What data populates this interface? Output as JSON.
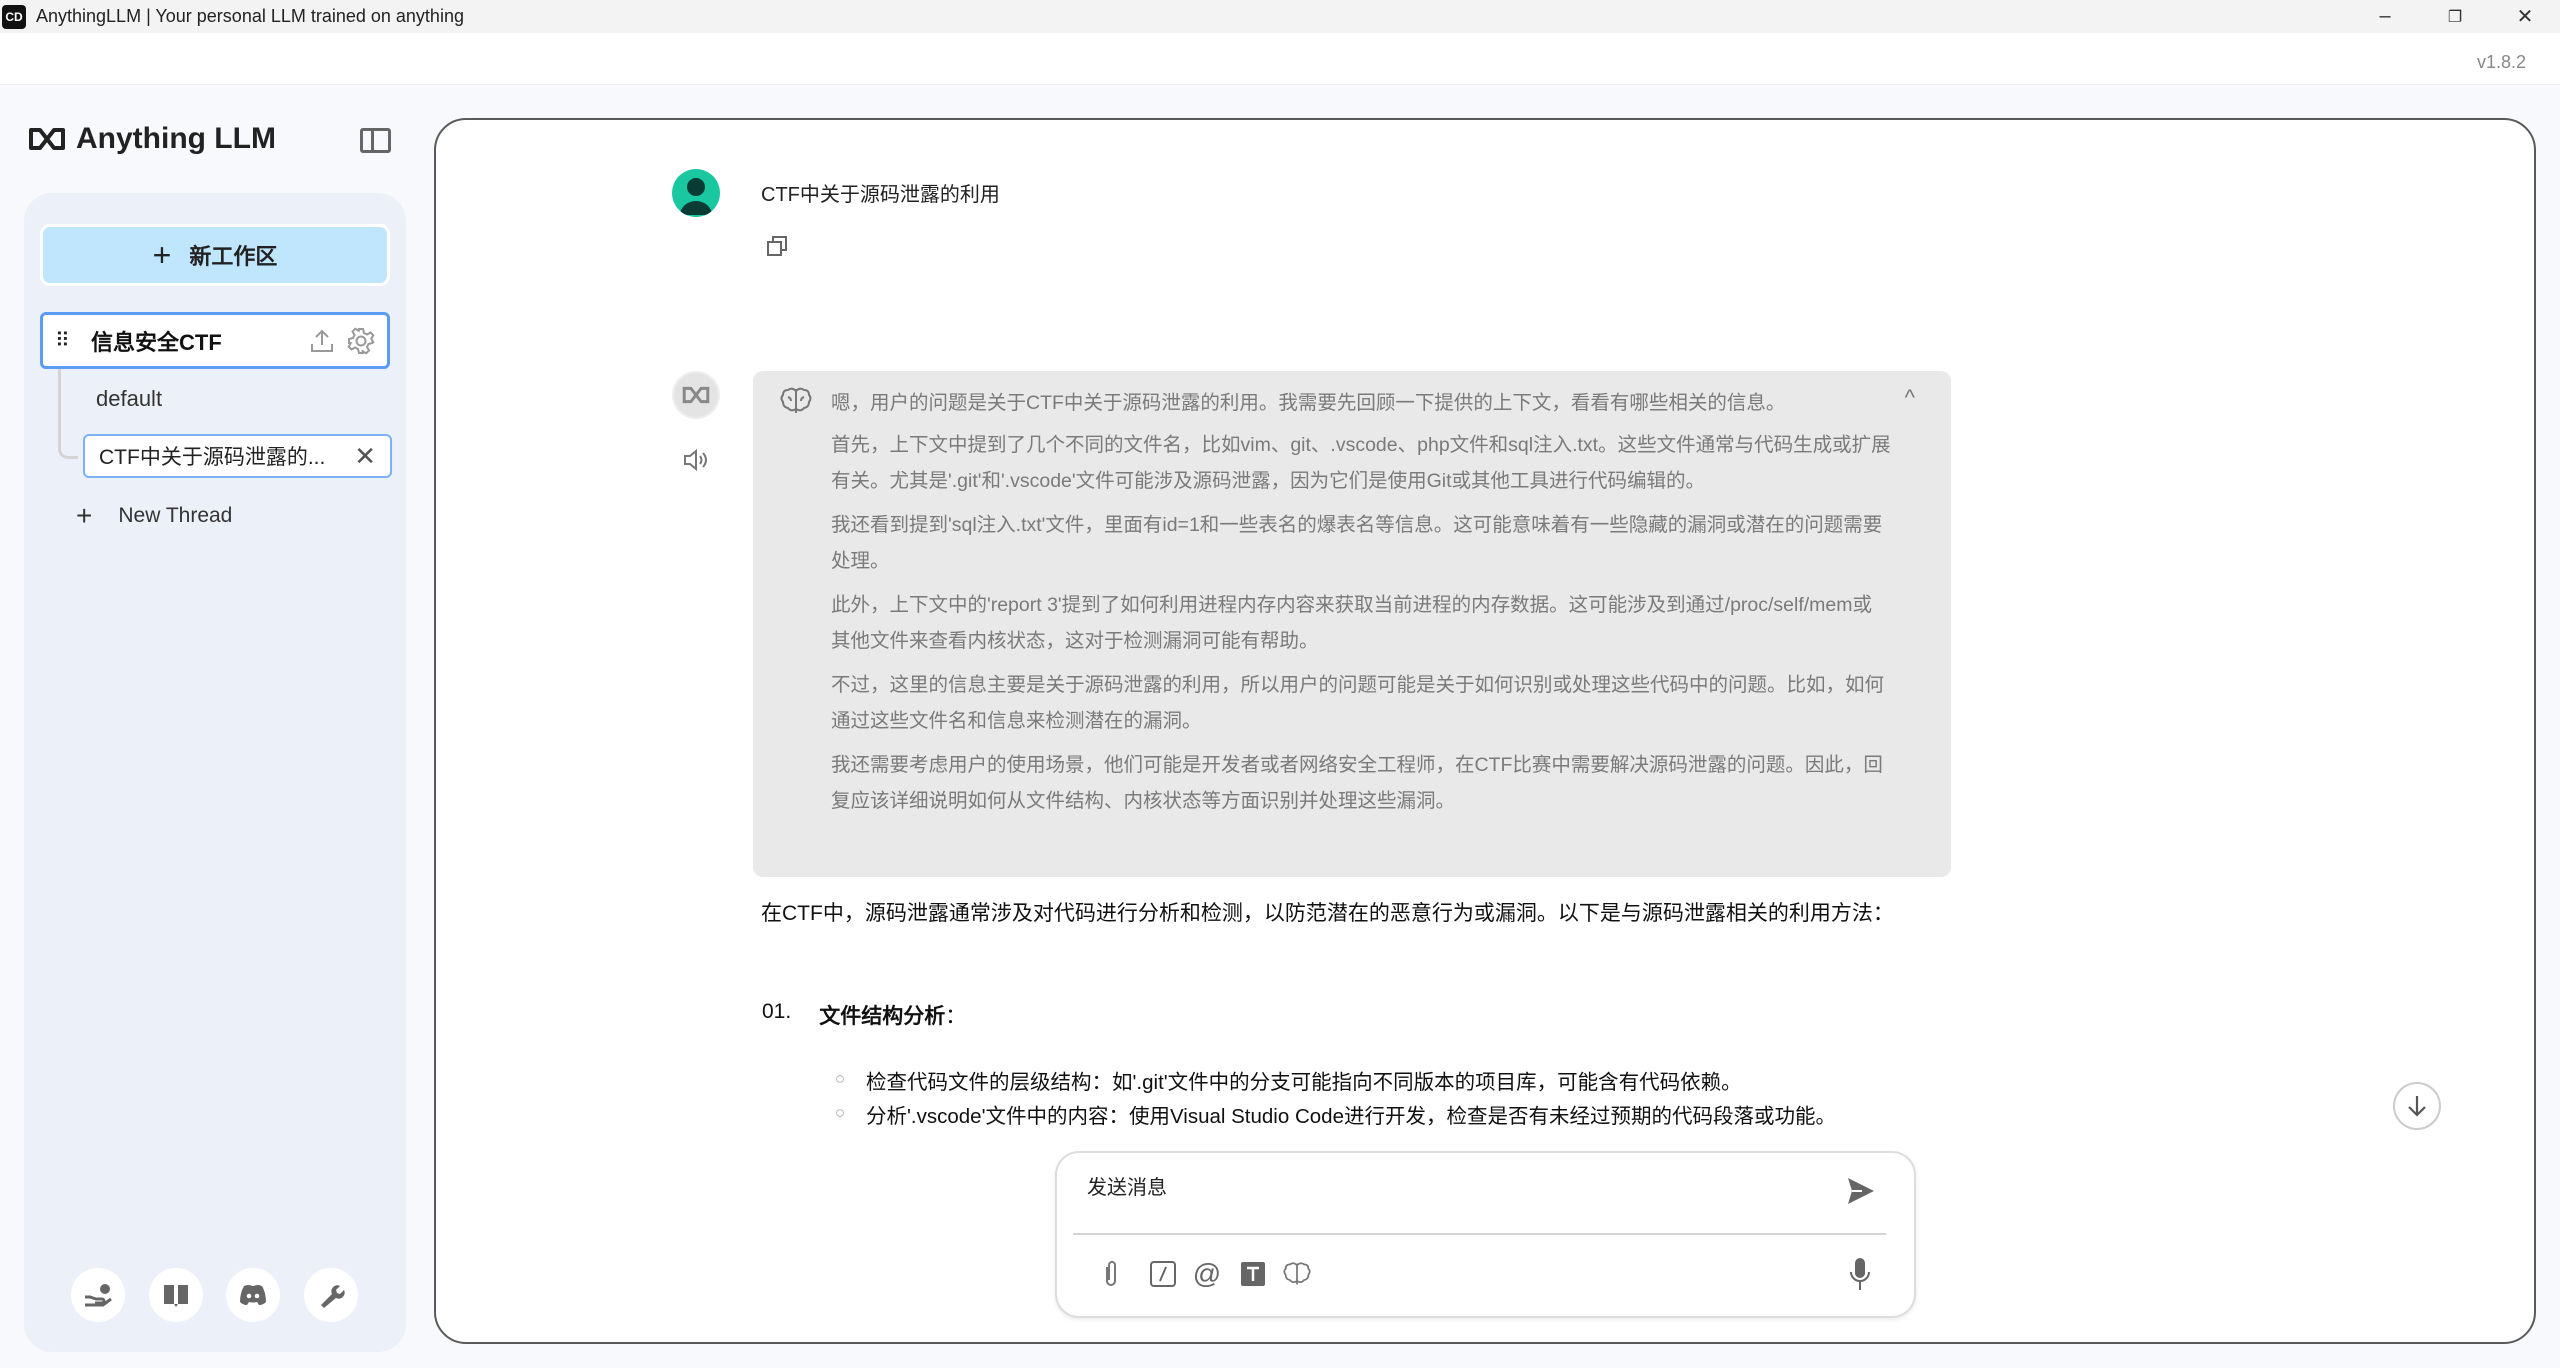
{
  "window": {
    "title": "AnythingLLM | Your personal LLM trained on anything",
    "app_icon": "CD",
    "minimize": "–",
    "maximize": "❐",
    "close": "✕"
  },
  "version": "v1.8.2",
  "sidebar": {
    "logo": "Anything LLM",
    "new_workspace": "新工作区",
    "workspace": {
      "name": "信息安全CTF"
    },
    "threads": [
      {
        "label": "default"
      },
      {
        "label": "CTF中关于源码泄露的..."
      }
    ],
    "new_thread": "New Thread"
  },
  "chat": {
    "user_message": "CTF中关于源码泄露的利用",
    "thinking": [
      "嗯，用户的问题是关于CTF中关于源码泄露的利用。我需要先回顾一下提供的上下文，看看有哪些相关的信息。",
      "首先，上下文中提到了几个不同的文件名，比如vim、git、.vscode、php文件和sql注入.txt。这些文件通常与代码生成或扩展有关。尤其是'.git'和'.vscode'文件可能涉及源码泄露，因为它们是使用Git或其他工具进行代码编辑的。",
      "我还看到提到'sql注入.txt'文件，里面有id=1和一些表名的爆表名等信息。这可能意味着有一些隐藏的漏洞或潜在的问题需要处理。",
      "此外，上下文中的'report 3'提到了如何利用进程内存内容来获取当前进程的内存数据。这可能涉及到通过/proc/self/mem或其他文件来查看内核状态，这对于检测漏洞可能有帮助。",
      "不过，这里的信息主要是关于源码泄露的利用，所以用户的问题可能是关于如何识别或处理这些代码中的问题。比如，如何通过这些文件名和信息来检测潜在的漏洞。",
      "我还需要考虑用户的使用场景，他们可能是开发者或者网络安全工程师，在CTF比赛中需要解决源码泄露的问题。因此，回复应该详细说明如何从文件结构、内核状态等方面识别并处理这些漏洞。"
    ],
    "response_intro": "在CTF中，源码泄露通常涉及对代码进行分析和检测，以防范潜在的恶意行为或漏洞。以下是与源码泄露相关的利用方法：",
    "list": [
      {
        "number": "01.",
        "heading": "文件结构分析",
        "suffix": "：",
        "bullets": [
          "检查代码文件的层级结构：如'.git'文件中的分支可能指向不同版本的项目库，可能含有代码依赖。",
          "分析'.vscode'文件中的内容：使用Visual Studio Code进行开发，检查是否有未经过预期的代码段落或功能。"
        ]
      }
    ]
  },
  "input": {
    "placeholder": "发送消息",
    "value": ""
  },
  "colors": {
    "accent": "#5c9cf5",
    "new_button": "#bfe6fd",
    "user_avatar": "#19c8a0",
    "thinking_bg": "#e9e9e9"
  }
}
